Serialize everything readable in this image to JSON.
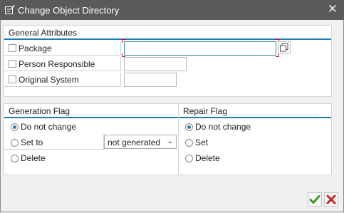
{
  "window": {
    "title": "Change Object Directory",
    "close_glyph": "✕"
  },
  "general": {
    "title": "General Attributes",
    "fields": [
      {
        "label": "Package",
        "value": ""
      },
      {
        "label": "Person Responsible",
        "value": ""
      },
      {
        "label": "Original System",
        "value": ""
      }
    ]
  },
  "generation": {
    "title": "Generation Flag",
    "options": [
      "Do not change",
      "Set to",
      "Delete"
    ],
    "selected": "Do not change",
    "select_value": "not generated"
  },
  "repair": {
    "title": "Repair Flag",
    "options": [
      "Do not change",
      "Set",
      "Delete"
    ],
    "selected": "Do not change"
  },
  "buttons": {
    "confirm_icon": "check-icon",
    "cancel_icon": "cancel-icon",
    "confirm_color": "#3a9a2a",
    "cancel_color": "#cc2222"
  }
}
